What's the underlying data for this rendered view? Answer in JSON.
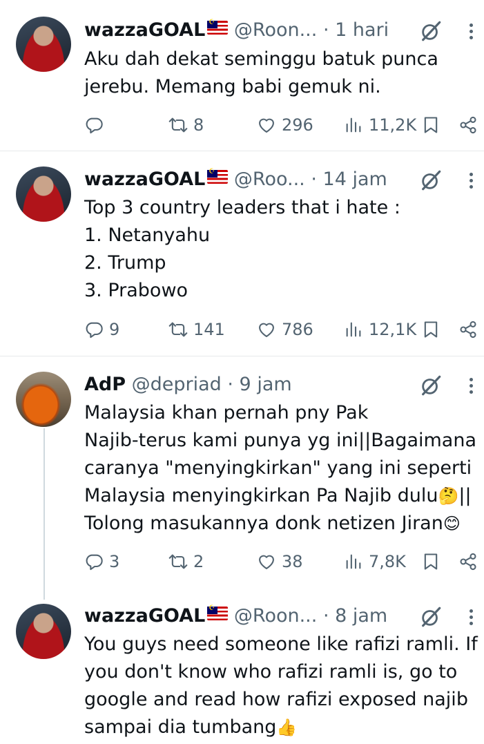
{
  "tweets": [
    {
      "name": "wazzaGOAL",
      "handle": "@Roon...",
      "time": "· 1 hari",
      "text": "Aku dah dekat seminggu batuk punca\njerebu. Memang babi gemuk ni.",
      "replies": "",
      "retweets": "8",
      "likes": "296",
      "views": "11,2K",
      "avatar": "person"
    },
    {
      "name": "wazzaGOAL",
      "handle": "@Roo...",
      "time": "· 14 jam",
      "text": "Top 3 country leaders that i hate :\n1. Netanyahu\n2. Trump\n3. Prabowo",
      "replies": "9",
      "retweets": "141",
      "likes": "786",
      "views": "12,1K",
      "avatar": "person"
    },
    {
      "name": "AdP",
      "handle": "@depriad",
      "time": "· 9 jam",
      "text_lines": [
        "Malaysia khan pernah pny Pak",
        "Najib-terus kami punya yg ini||Bagaimana",
        "caranya \"menyingkirkan\" yang ini seperti",
        "Malaysia menyingkirkan Pa Najib dulu",
        "Tolong masukannya donk netizen Jiran"
      ],
      "replies": "3",
      "retweets": "2",
      "likes": "38",
      "views": "7,8K",
      "avatar": "orange"
    },
    {
      "name": "wazzaGOAL",
      "handle": "@Roon...",
      "time": "· 8 jam",
      "text_lines": [
        "You guys need someone like rafizi ramli. If",
        "you don't know who rafizi ramli is, go to",
        "google and read how rafizi exposed najib",
        "sampai dia tumbang"
      ],
      "avatar": "person"
    }
  ],
  "emoji": {
    "thinking": "🤔",
    "pipes": "||",
    "smile": "😊",
    "thumbs": "👍"
  },
  "colors": {
    "text": "#0f1419",
    "muted": "#536471",
    "divider": "#e7e9ea"
  },
  "icons": [
    "reply-icon",
    "retweet-icon",
    "like-icon",
    "views-icon",
    "bookmark-icon",
    "share-icon",
    "grok-icon",
    "more-icon"
  ]
}
